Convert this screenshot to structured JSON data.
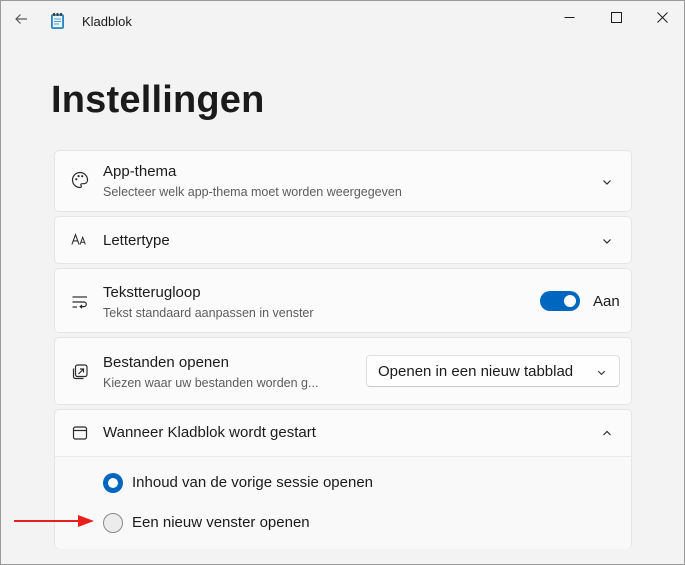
{
  "window": {
    "title": "Kladblok"
  },
  "page": {
    "title": "Instellingen"
  },
  "settings": {
    "app_theme": {
      "title": "App-thema",
      "subtitle": "Selecteer welk app-thema moet worden weergegeven",
      "icon": "palette-icon"
    },
    "font": {
      "title": "Lettertype",
      "icon": "font-icon"
    },
    "word_wrap": {
      "title": "Tekstterugloop",
      "subtitle": "Tekst standaard aanpassen in venster",
      "toggle_label": "Aan",
      "toggle_on": true,
      "icon": "word-wrap-icon"
    },
    "open_files": {
      "title": "Bestanden openen",
      "subtitle": "Kiezen waar uw bestanden worden g...",
      "dropdown_value": "Openen in een nieuw tabblad",
      "icon": "open-file-icon"
    },
    "startup": {
      "title": "Wanneer Kladblok wordt gestart",
      "icon": "window-icon",
      "options": [
        {
          "label": "Inhoud van de vorige sessie openen",
          "selected": true
        },
        {
          "label": "Een nieuw venster openen",
          "selected": false
        }
      ]
    }
  },
  "colors": {
    "accent": "#0067c0",
    "annotation_arrow": "#e8201c"
  }
}
